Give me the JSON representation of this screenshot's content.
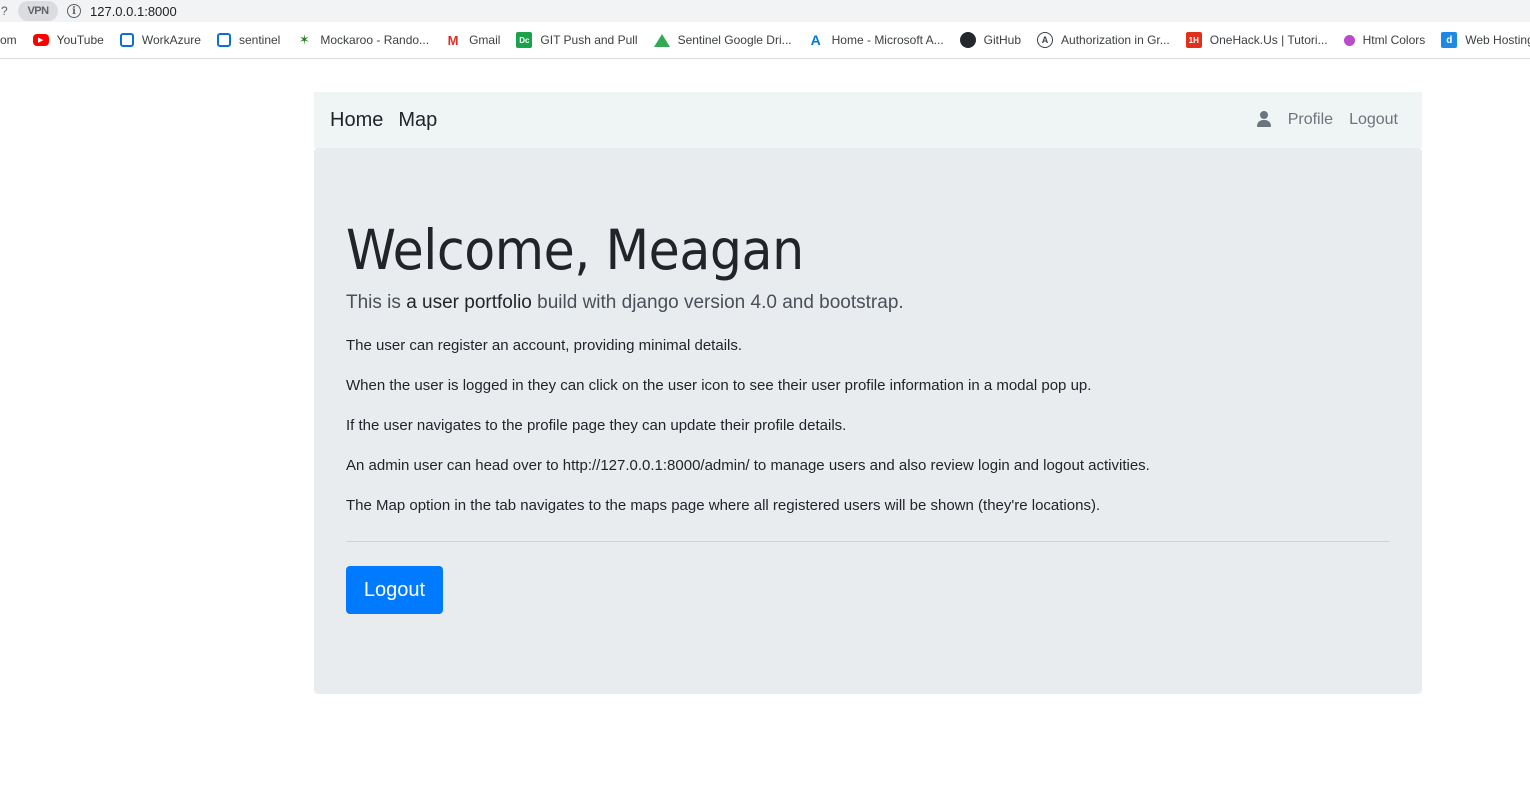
{
  "browser": {
    "left_edge_glyph": "?",
    "vpn_label": "VPN",
    "info_icon_glyph": "i",
    "url": "127.0.0.1:8000"
  },
  "bookmarks": {
    "cut_off_first": "om",
    "items": [
      {
        "label": "YouTube",
        "icon": "youtube-icon",
        "glyph": "▶"
      },
      {
        "label": "WorkAzure",
        "icon": "azure-devops-icon",
        "glyph": ""
      },
      {
        "label": "sentinel",
        "icon": "azure-devops-icon",
        "glyph": ""
      },
      {
        "label": "Mockaroo - Rando...",
        "icon": "mockaroo-icon",
        "glyph": "✶"
      },
      {
        "label": "Gmail",
        "icon": "gmail-icon",
        "glyph": "M"
      },
      {
        "label": "GIT Push and Pull",
        "icon": "git-icon",
        "glyph": "Dc"
      },
      {
        "label": "Sentinel Google Dri...",
        "icon": "google-drive-icon",
        "glyph": ""
      },
      {
        "label": "Home - Microsoft A...",
        "icon": "microsoft-azure-icon",
        "glyph": "A"
      },
      {
        "label": "GitHub",
        "icon": "github-icon",
        "glyph": ""
      },
      {
        "label": "Authorization in Gr...",
        "icon": "auth0-icon",
        "glyph": "A"
      },
      {
        "label": "OneHack.Us | Tutori...",
        "icon": "onehack-icon",
        "glyph": "1H"
      },
      {
        "label": "Html Colors",
        "icon": "html-colors-icon",
        "glyph": ""
      },
      {
        "label": "Web Hosting",
        "icon": "web-hosting-icon",
        "glyph": "d"
      }
    ]
  },
  "navbar": {
    "home": "Home",
    "map": "Map",
    "profile": "Profile",
    "logout": "Logout"
  },
  "jumbotron": {
    "title": "Welcome, Meagan",
    "lead_prefix": "This is",
    "lead_emphasis": "a user portfolio",
    "lead_suffix": "build with django version 4.0 and bootstrap.",
    "paragraphs": [
      "The user can register an account, providing minimal details.",
      "When the user is logged in they can click on the user icon to see their user profile information in a modal pop up.",
      "If the user navigates to the profile page they can update their profile details.",
      "An admin user can head over to http://127.0.0.1:8000/admin/ to manage users and also review login and logout activities.",
      "The Map option in the tab navigates to the maps page where all registered users will be shown (they're locations)."
    ],
    "button_label": "Logout"
  },
  "colors": {
    "primary_button": "#007bff",
    "jumbotron_bg": "#e9ecef",
    "navbar_bg": "#eff4f4"
  }
}
